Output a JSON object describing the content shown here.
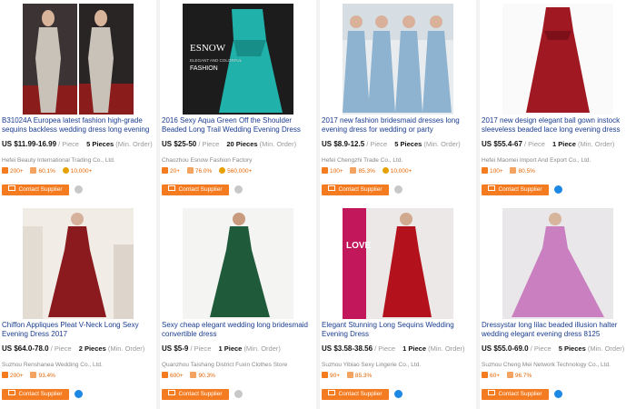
{
  "products": [
    {
      "title": "B31024A Europea latest fashion high-grade sequins backless wedding dress long evening",
      "price": "US $11.99-16.99",
      "unit": "/ Piece",
      "qty": "5 Pieces",
      "min_order": "(Min. Order)",
      "company": "Hefei Beauty International Trading Co., Ltd.",
      "stats": [
        {
          "icon": "orders-icon",
          "value": "200+"
        },
        {
          "icon": "response-icon",
          "value": "60.1%"
        },
        {
          "icon": "revenue-icon",
          "value": "10,000+"
        }
      ],
      "contact_label": "Contact Supplier",
      "chat_status": "offline",
      "image": "sequin-dress-photo"
    },
    {
      "title": "2016 Sexy Aqua Green Off the Shoulder Beaded Long Trail Wedding Evening Dress",
      "price": "US $25-50",
      "unit": "/ Piece",
      "qty": "20 Pieces",
      "min_order": "(Min. Order)",
      "company": "Chaozhou Esnow Fashion Factory",
      "stats": [
        {
          "icon": "orders-icon",
          "value": "20+"
        },
        {
          "icon": "response-icon",
          "value": "76.0%"
        },
        {
          "icon": "revenue-icon",
          "value": "560,000+"
        }
      ],
      "contact_label": "Contact Supplier",
      "chat_status": "offline",
      "image": "aqua-dress-photo",
      "image_text": {
        "brand": "ESNOW",
        "line1": "ELEGANT AND COLORFUL",
        "line2": "FASHION"
      }
    },
    {
      "title": "2017 new fashion bridesmaid dresses long evening dress for wedding or party",
      "price": "US $8.9-12.5",
      "unit": "/ Piece",
      "qty": "5 Pieces",
      "min_order": "(Min. Order)",
      "company": "Hefei Chengzhi Trade Co., Ltd.",
      "stats": [
        {
          "icon": "orders-icon",
          "value": "100+"
        },
        {
          "icon": "response-icon",
          "value": "85.3%"
        },
        {
          "icon": "revenue-icon",
          "value": "10,000+"
        }
      ],
      "contact_label": "Contact Supplier",
      "chat_status": "offline",
      "image": "bridesmaids-photo"
    },
    {
      "title": "2017 new design elegant ball gown instock sleeveless beaded lace long evening dress",
      "price": "US $55.4-67",
      "unit": "/ Piece",
      "qty": "1 Piece",
      "min_order": "(Min. Order)",
      "company": "Hefei Maomei Import And Export Co., Ltd.",
      "stats": [
        {
          "icon": "orders-icon",
          "value": "100+"
        },
        {
          "icon": "response-icon",
          "value": "80.5%"
        }
      ],
      "contact_label": "Contact Supplier",
      "chat_status": "online",
      "image": "red-lace-dress-photo"
    },
    {
      "title": "Chiffon Appliques Pleat V-Neck Long Sexy Evening Dress 2017",
      "price": "US $64.0-78.0",
      "unit": "/ Piece",
      "qty": "2 Pieces",
      "min_order": "(Min. Order)",
      "company": "Suzhou Renshanea Wedding Co., Ltd.",
      "stats": [
        {
          "icon": "orders-icon",
          "value": "200+"
        },
        {
          "icon": "response-icon",
          "value": "93.4%"
        }
      ],
      "contact_label": "Contact Supplier",
      "chat_status": "online",
      "image": "burgundy-chiffon-photo"
    },
    {
      "title": "Sexy cheap elegant wedding long bridesmaid convertible dress",
      "price": "US $5-9",
      "unit": "/ Piece",
      "qty": "1 Piece",
      "min_order": "(Min. Order)",
      "company": "Quanzhou Taishang District Fuxin Clothes Store",
      "stats": [
        {
          "icon": "orders-icon",
          "value": "600+"
        },
        {
          "icon": "response-icon",
          "value": "90.3%"
        }
      ],
      "contact_label": "Contact Supplier",
      "chat_status": "offline",
      "image": "green-dress-photo"
    },
    {
      "title": "Elegant Stunning Long Sequins Wedding Evening Dress",
      "price": "US $3.58-38.56",
      "unit": "/ Piece",
      "qty": "1 Piece",
      "min_order": "(Min. Order)",
      "company": "Suzhou Yibiao Sexy Lingerie Co., Ltd.",
      "stats": [
        {
          "icon": "orders-icon",
          "value": "90+"
        },
        {
          "icon": "response-icon",
          "value": "85.3%"
        }
      ],
      "contact_label": "Contact Supplier",
      "chat_status": "online",
      "image": "red-sequin-dress-photo",
      "image_text": {
        "banner": "LOVE"
      }
    },
    {
      "title": "Dressystar long lilac beaded illusion halter wedding elegant evening dress 8125",
      "price": "US $55.0-69.0",
      "unit": "/ Piece",
      "qty": "5 Pieces",
      "min_order": "(Min. Order)",
      "company": "Suzhou Cheng Mei Network Technology Co., Ltd.",
      "stats": [
        {
          "icon": "orders-icon",
          "value": "60+"
        },
        {
          "icon": "response-icon",
          "value": "96.7%"
        }
      ],
      "contact_label": "Contact Supplier",
      "chat_status": "online",
      "image": "lilac-dress-photo"
    }
  ],
  "colors": {
    "title": "#1a3d8f",
    "accent": "#f47b20",
    "stat_value": "#e56400",
    "chat_online": "#1e88e5",
    "chat_offline": "#c8c8c8"
  }
}
